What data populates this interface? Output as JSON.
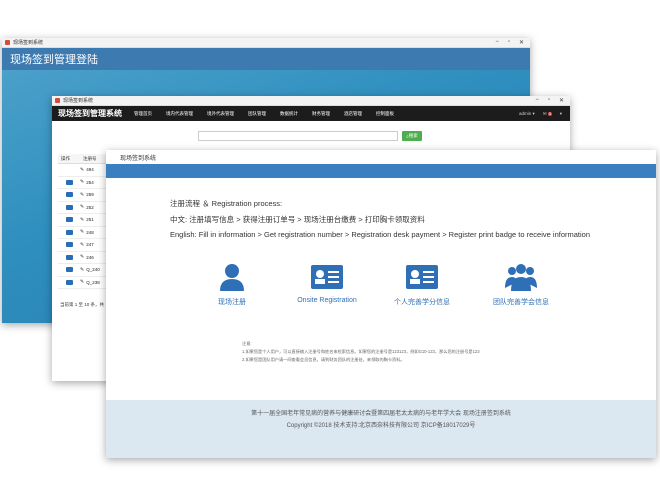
{
  "window1": {
    "titlebar_title": "现场签到系统",
    "header_title": "现场签到管理登陆",
    "controls": [
      "−",
      "▫",
      "✕"
    ]
  },
  "window2": {
    "titlebar_title": "现场签到系统",
    "brand": "现场签到管理系统",
    "menu": [
      "管理首页",
      "境内代表管理",
      "境外代表管理",
      "团队管理",
      "数据统计",
      "财务管理",
      "酒店管理",
      "控制面板"
    ],
    "user": "admin ▾",
    "badge": "3",
    "search_button": "搜索",
    "table_headers": [
      "操作",
      "注册号"
    ],
    "rows": [
      "494",
      "254",
      "259",
      "252",
      "251",
      "248",
      "247",
      "246",
      "Q_240",
      "Q_238"
    ],
    "footer": "当前第 1 至 10 条，共"
  },
  "window3": {
    "titlebar_title": "现场签到系统",
    "process_title": "注册流程 ＆ Registration process:",
    "process_cn": "中文: 注册填写信息 > 获得注册订单号 > 现场注册台缴费 > 打印胸卡领取资料",
    "process_en": "English: Fill in information > Get registration number > Registration desk payment > Register print badge to receive information",
    "icons": [
      {
        "icon": "person-icon",
        "label": "现场注册"
      },
      {
        "icon": "id-card-icon",
        "label": "Onsite Registration"
      },
      {
        "icon": "id-card-icon",
        "label": "个人完善学分信息"
      },
      {
        "icon": "group-icon",
        "label": "团队完善学会信息"
      }
    ],
    "notes": [
      "注意:",
      "1.如果您是个人用户，可以直接输入注册号和姓名来检索信息。如果您的注册号是123123，例如G10-123，那么您的注册号是123",
      "2.如果您是团队用户请一间查看会员信息，请到财务团队的注册处，来领取的胸卡资料。"
    ],
    "footer_line1": "第十一届全国老年常见病的营养与健康研讨会暨第四届老太太病的与老年学大会 现场注册签到系统",
    "footer_line2": "Copyright ©2018 技术支持:北京西奈科技有限公司 京ICP备18017029号"
  },
  "colors": {
    "accent_blue": "#3a80c1",
    "nav_dark": "#1c1c1c",
    "search_green": "#4cae4c"
  }
}
